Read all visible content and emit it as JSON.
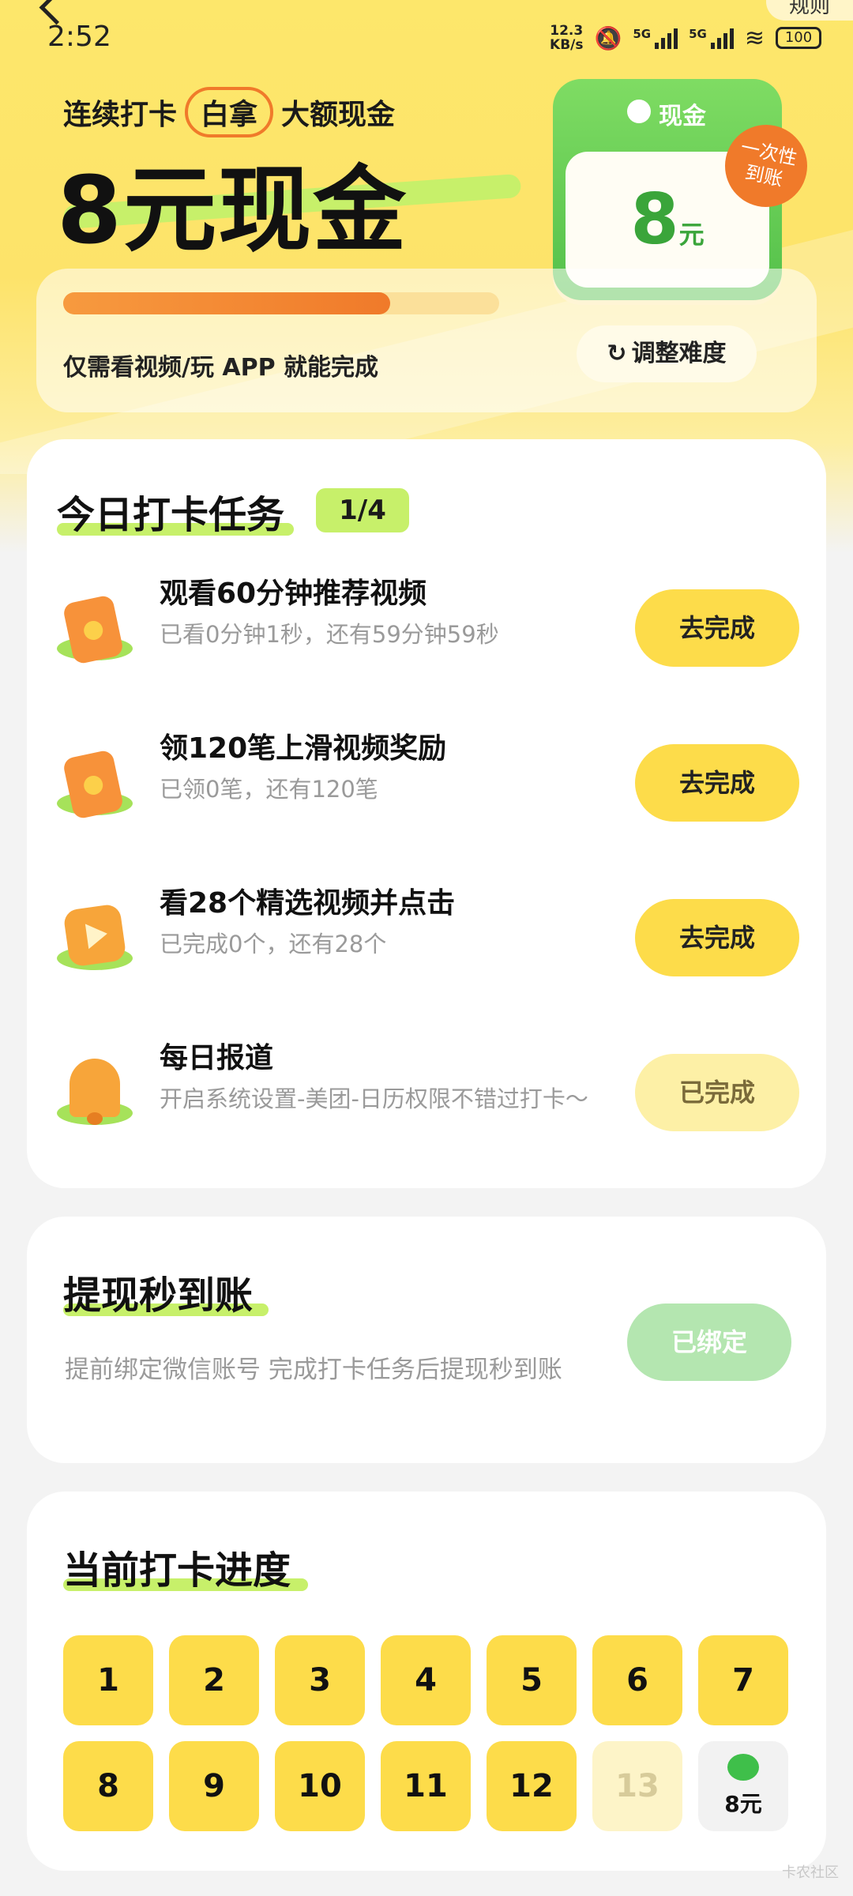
{
  "status_bar": {
    "time": "2:52",
    "net_speed": "12.3",
    "net_unit": "KB/s",
    "sim1": "5G",
    "sim2": "5G",
    "battery": "100",
    "icons": [
      "mute-bell-icon",
      "signal-icon",
      "signal-icon",
      "wifi-icon",
      "battery-icon"
    ]
  },
  "header": {
    "rules_label": "规则"
  },
  "hero": {
    "line1_a": "连续打卡",
    "line1_circled": "白拿",
    "line1_b": "大额现金",
    "big_title": "8元现金",
    "cash_card_label": "现金",
    "cash_amount": "8",
    "cash_unit": "元",
    "one_time_badge_1": "一次性",
    "one_time_badge_2": "到账",
    "progress_fraction": 0.75,
    "progress_caption": "仅需看视频/玩 APP 就能完成",
    "adjust_label": "调整难度"
  },
  "tasks": {
    "title": "今日打卡任务",
    "count": "1/4",
    "items": [
      {
        "icon": "red-packet-icon",
        "title": "观看60分钟推荐视频",
        "subtitle": "已看0分钟1秒，还有59分钟59秒",
        "button": "去完成",
        "done": false
      },
      {
        "icon": "red-packet-icon",
        "title": "领120笔上滑视频奖励",
        "subtitle": "已领0笔，还有120笔",
        "button": "去完成",
        "done": false
      },
      {
        "icon": "play-icon",
        "title": "看28个精选视频并点击",
        "subtitle": "已完成0个，还有28个",
        "button": "去完成",
        "done": false
      },
      {
        "icon": "bell-icon",
        "title": "每日报道",
        "subtitle": "开启系统设置-美团-日历权限不错过打卡～",
        "button": "已完成",
        "done": true
      }
    ]
  },
  "withdraw": {
    "title": "提现秒到账",
    "desc": "提前绑定微信账号 完成打卡任务后提现秒到账",
    "button": "已绑定"
  },
  "checkin": {
    "title": "当前打卡进度",
    "days": [
      "1",
      "2",
      "3",
      "4",
      "5",
      "6",
      "7",
      "8",
      "9",
      "10",
      "11",
      "12",
      "13"
    ],
    "completed_days": 12,
    "reward_label": "8元"
  },
  "watermark": "卡农社区",
  "colors": {
    "accent_yellow": "#fddc4a",
    "accent_green": "#53c04a",
    "accent_orange": "#f07a2a",
    "highlight_green": "#c7f06a"
  }
}
